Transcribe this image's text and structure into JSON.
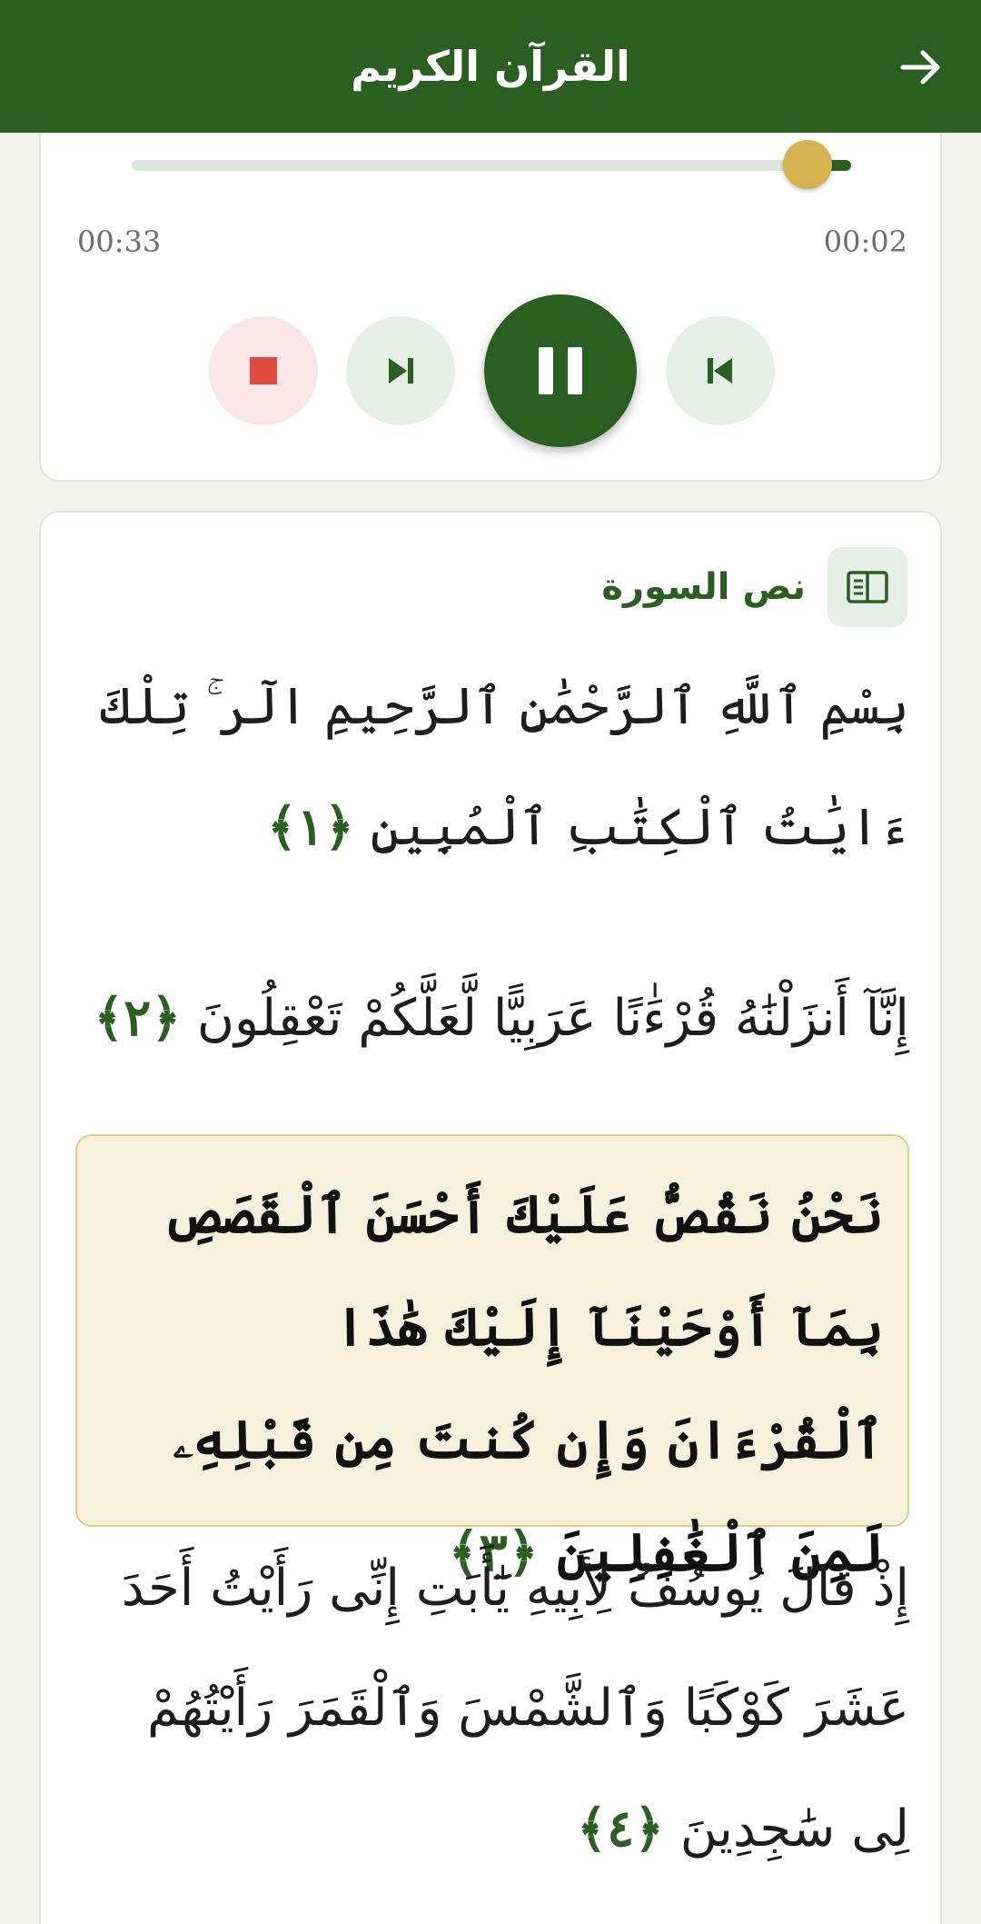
{
  "app_bar": {
    "title": "القرآن الكريم",
    "back_icon": "arrow-right-icon"
  },
  "player": {
    "progress_fraction": 0.06,
    "elapsed": "00:02",
    "total": "00:33",
    "controls": {
      "stop_icon": "stop-icon",
      "next_icon": "skip-next-icon",
      "play_pause_icon": "pause-icon",
      "prev_icon": "skip-previous-icon"
    },
    "colors": {
      "primary": "#2b5e21",
      "thumb": "#d4b24f",
      "stop": "#e24c3f"
    }
  },
  "surah_text": {
    "header_icon": "book-open-icon",
    "title": "نص السورة",
    "verses": [
      {
        "text": "بِسْمِ ٱللَّهِ ٱلرَّحْمَٰنِ ٱلرَّحِيمِ الٓر ۚ تِلْكَ ءَايَٰتُ ٱلْكِتَٰبِ ٱلْمُبِينِ",
        "marker": "﴿١﴾"
      },
      {
        "text": "إِنَّآ أَنزَلْنَٰهُ قُرْءَٰنًا عَرَبِيًّا لَّعَلَّكُمْ تَعْقِلُونَ",
        "marker": "﴿٢﴾"
      },
      {
        "text": "نَحْنُ نَقُصُّ عَلَيْكَ أَحْسَنَ ٱلْقَصَصِ بِمَآ أَوْحَيْنَآ إِلَيْكَ هَٰذَا ٱلْقُرْءَانَ وَإِن كُنتَ مِن قَبْلِهِۦ لَمِنَ ٱلْغَٰفِلِينَ",
        "marker": "﴿٣﴾",
        "highlighted": true
      },
      {
        "text": "إِذْ قَالَ يُوسُفُ لِأَبِيهِ يَٰٓأَبَتِ إِنِّى رَأَيْتُ أَحَدَ عَشَرَ كَوْكَبًا وَٱلشَّمْسَ وَٱلْقَمَرَ رَأَيْتُهُمْ لِى سَٰجِدِينَ",
        "marker": "﴿٤﴾"
      }
    ],
    "colors": {
      "highlight_bg": "#f6f0dc",
      "highlight_border": "#e0cd8c"
    }
  }
}
